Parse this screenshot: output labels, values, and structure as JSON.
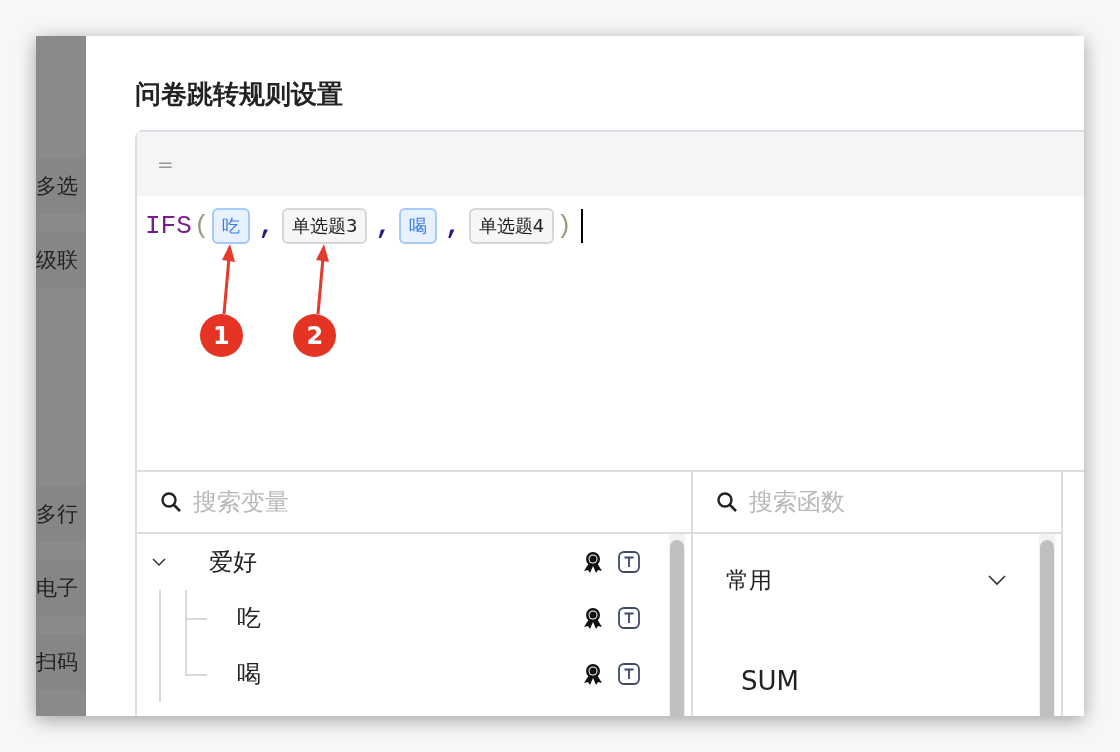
{
  "background_items": [
    {
      "label": "多选"
    },
    {
      "label": "级联"
    },
    {
      "label": "多行"
    },
    {
      "label": "电子"
    },
    {
      "label": "扫码"
    }
  ],
  "dialog": {
    "title": "问卷跳转规则设置",
    "editor": {
      "header": "=",
      "formula": [
        {
          "kind": "function",
          "text": "IFS"
        },
        {
          "kind": "paren",
          "text": "("
        },
        {
          "kind": "field",
          "text": "吃",
          "annotation": "1"
        },
        {
          "kind": "comma",
          "text": ","
        },
        {
          "kind": "question",
          "text": "单选题3",
          "annotation": "2"
        },
        {
          "kind": "comma",
          "text": ","
        },
        {
          "kind": "field",
          "text": "喝"
        },
        {
          "kind": "comma",
          "text": ","
        },
        {
          "kind": "question",
          "text": "单选题4"
        },
        {
          "kind": "paren",
          "text": ")"
        }
      ]
    },
    "variables": {
      "search": {
        "placeholder": "搜索变量"
      },
      "tree": [
        {
          "label": "爱好",
          "expanded": true,
          "children": [
            {
              "label": "吃"
            },
            {
              "label": "喝"
            }
          ]
        }
      ]
    },
    "functions": {
      "search": {
        "placeholder": "搜索函数"
      },
      "groups": [
        {
          "label": "常用",
          "expanded": true,
          "items": [
            {
              "name": "SUM"
            }
          ]
        }
      ]
    }
  }
}
